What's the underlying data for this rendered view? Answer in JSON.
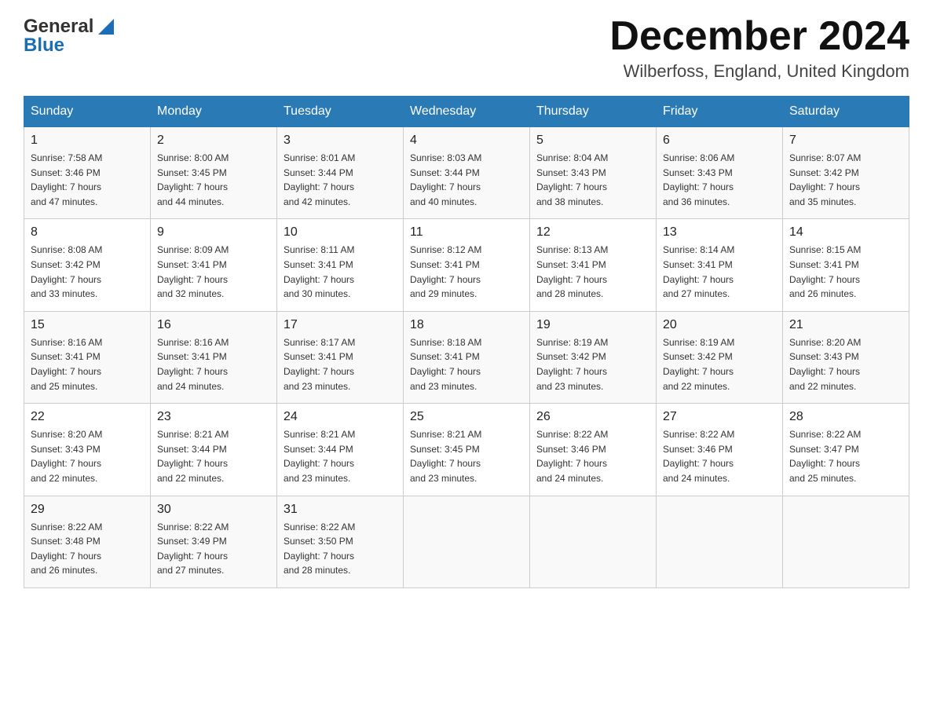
{
  "header": {
    "logo_general": "General",
    "logo_blue": "Blue",
    "month_title": "December 2024",
    "location": "Wilberfoss, England, United Kingdom"
  },
  "weekdays": [
    "Sunday",
    "Monday",
    "Tuesday",
    "Wednesday",
    "Thursday",
    "Friday",
    "Saturday"
  ],
  "weeks": [
    [
      {
        "day": "1",
        "sunrise": "7:58 AM",
        "sunset": "3:46 PM",
        "daylight": "7 hours and 47 minutes."
      },
      {
        "day": "2",
        "sunrise": "8:00 AM",
        "sunset": "3:45 PM",
        "daylight": "7 hours and 44 minutes."
      },
      {
        "day": "3",
        "sunrise": "8:01 AM",
        "sunset": "3:44 PM",
        "daylight": "7 hours and 42 minutes."
      },
      {
        "day": "4",
        "sunrise": "8:03 AM",
        "sunset": "3:44 PM",
        "daylight": "7 hours and 40 minutes."
      },
      {
        "day": "5",
        "sunrise": "8:04 AM",
        "sunset": "3:43 PM",
        "daylight": "7 hours and 38 minutes."
      },
      {
        "day": "6",
        "sunrise": "8:06 AM",
        "sunset": "3:43 PM",
        "daylight": "7 hours and 36 minutes."
      },
      {
        "day": "7",
        "sunrise": "8:07 AM",
        "sunset": "3:42 PM",
        "daylight": "7 hours and 35 minutes."
      }
    ],
    [
      {
        "day": "8",
        "sunrise": "8:08 AM",
        "sunset": "3:42 PM",
        "daylight": "7 hours and 33 minutes."
      },
      {
        "day": "9",
        "sunrise": "8:09 AM",
        "sunset": "3:41 PM",
        "daylight": "7 hours and 32 minutes."
      },
      {
        "day": "10",
        "sunrise": "8:11 AM",
        "sunset": "3:41 PM",
        "daylight": "7 hours and 30 minutes."
      },
      {
        "day": "11",
        "sunrise": "8:12 AM",
        "sunset": "3:41 PM",
        "daylight": "7 hours and 29 minutes."
      },
      {
        "day": "12",
        "sunrise": "8:13 AM",
        "sunset": "3:41 PM",
        "daylight": "7 hours and 28 minutes."
      },
      {
        "day": "13",
        "sunrise": "8:14 AM",
        "sunset": "3:41 PM",
        "daylight": "7 hours and 27 minutes."
      },
      {
        "day": "14",
        "sunrise": "8:15 AM",
        "sunset": "3:41 PM",
        "daylight": "7 hours and 26 minutes."
      }
    ],
    [
      {
        "day": "15",
        "sunrise": "8:16 AM",
        "sunset": "3:41 PM",
        "daylight": "7 hours and 25 minutes."
      },
      {
        "day": "16",
        "sunrise": "8:16 AM",
        "sunset": "3:41 PM",
        "daylight": "7 hours and 24 minutes."
      },
      {
        "day": "17",
        "sunrise": "8:17 AM",
        "sunset": "3:41 PM",
        "daylight": "7 hours and 23 minutes."
      },
      {
        "day": "18",
        "sunrise": "8:18 AM",
        "sunset": "3:41 PM",
        "daylight": "7 hours and 23 minutes."
      },
      {
        "day": "19",
        "sunrise": "8:19 AM",
        "sunset": "3:42 PM",
        "daylight": "7 hours and 23 minutes."
      },
      {
        "day": "20",
        "sunrise": "8:19 AM",
        "sunset": "3:42 PM",
        "daylight": "7 hours and 22 minutes."
      },
      {
        "day": "21",
        "sunrise": "8:20 AM",
        "sunset": "3:43 PM",
        "daylight": "7 hours and 22 minutes."
      }
    ],
    [
      {
        "day": "22",
        "sunrise": "8:20 AM",
        "sunset": "3:43 PM",
        "daylight": "7 hours and 22 minutes."
      },
      {
        "day": "23",
        "sunrise": "8:21 AM",
        "sunset": "3:44 PM",
        "daylight": "7 hours and 22 minutes."
      },
      {
        "day": "24",
        "sunrise": "8:21 AM",
        "sunset": "3:44 PM",
        "daylight": "7 hours and 23 minutes."
      },
      {
        "day": "25",
        "sunrise": "8:21 AM",
        "sunset": "3:45 PM",
        "daylight": "7 hours and 23 minutes."
      },
      {
        "day": "26",
        "sunrise": "8:22 AM",
        "sunset": "3:46 PM",
        "daylight": "7 hours and 24 minutes."
      },
      {
        "day": "27",
        "sunrise": "8:22 AM",
        "sunset": "3:46 PM",
        "daylight": "7 hours and 24 minutes."
      },
      {
        "day": "28",
        "sunrise": "8:22 AM",
        "sunset": "3:47 PM",
        "daylight": "7 hours and 25 minutes."
      }
    ],
    [
      {
        "day": "29",
        "sunrise": "8:22 AM",
        "sunset": "3:48 PM",
        "daylight": "7 hours and 26 minutes."
      },
      {
        "day": "30",
        "sunrise": "8:22 AM",
        "sunset": "3:49 PM",
        "daylight": "7 hours and 27 minutes."
      },
      {
        "day": "31",
        "sunrise": "8:22 AM",
        "sunset": "3:50 PM",
        "daylight": "7 hours and 28 minutes."
      },
      null,
      null,
      null,
      null
    ]
  ],
  "labels": {
    "sunrise": "Sunrise:",
    "sunset": "Sunset:",
    "daylight": "Daylight:"
  }
}
